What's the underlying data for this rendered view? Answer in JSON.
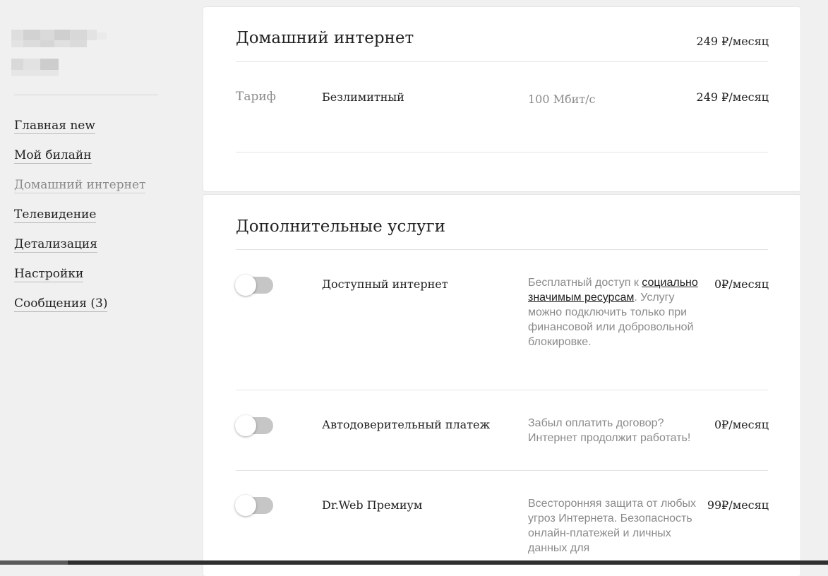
{
  "sidebar": {
    "menu": [
      {
        "label": "Главная new",
        "active": false
      },
      {
        "label": "Мой билайн",
        "active": false
      },
      {
        "label": "Домашний интернет",
        "active": true
      },
      {
        "label": "Телевидение",
        "active": false
      },
      {
        "label": "Детализация",
        "active": false
      },
      {
        "label": "Настройки",
        "active": false
      },
      {
        "label": "Сообщения (3)",
        "active": false
      }
    ]
  },
  "home_internet": {
    "title": "Домашний интернет",
    "total_price": "249 ₽/месяц",
    "tariff": {
      "label": "Тариф",
      "name": "Безлимитный",
      "speed": "100 Мбит/с",
      "price": "249 ₽/месяц"
    }
  },
  "extra_services": {
    "title": "Дополнительные услуги",
    "items": [
      {
        "name": "Доступный интернет",
        "enabled": false,
        "desc_before": "Бесплатный доступ к ",
        "desc_link": "социально значимым ресурсам",
        "desc_after": ". Услугу можно подключить только при финансовой или добровольной блокировке.",
        "price": "0₽/месяц"
      },
      {
        "name": "Автодоверительный платеж",
        "enabled": false,
        "description": "Забыл оплатить договор? Интернет продолжит работать!",
        "price": "0₽/месяц"
      },
      {
        "name": "Dr.Web Премиум",
        "enabled": false,
        "description": "Всесторонняя защита от любых угроз Интернета. Безопасность онлайн-платежей и личных данных для",
        "price": "99₽/месяц"
      }
    ]
  },
  "colors": {
    "background": "#f0f0f0",
    "card": "#ffffff",
    "muted_text": "#8a8a8a",
    "toggle_off": "#c6c6c6"
  }
}
